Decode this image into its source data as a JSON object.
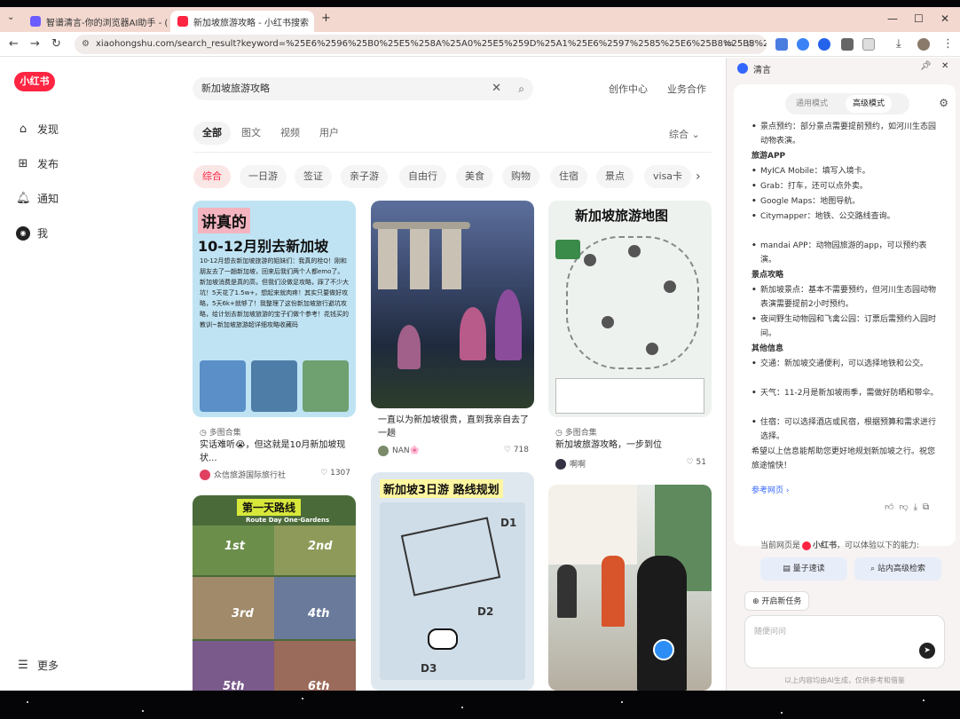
{
  "browser": {
    "tabs": [
      {
        "title": "智谱清言-你的浏览器AI助手 - (",
        "active": false
      },
      {
        "title": "新加坡旅游攻略 - 小红书搜索",
        "active": true
      }
    ],
    "new_tab": "+",
    "url": "xiaohongshu.com/search_result?keyword=%25E6%2596%25B0%25E5%258A%25A0%25E5%259D%25A1%25E6%2597%2585%25E6%25B8%25B8%2..."
  },
  "sidebar": {
    "logo": "小红书",
    "items": [
      {
        "label": "发现",
        "icon": "home-icon"
      },
      {
        "label": "发布",
        "icon": "plus-square-icon"
      },
      {
        "label": "通知",
        "icon": "bell-icon"
      },
      {
        "label": "我",
        "icon": "avatar-icon"
      }
    ],
    "more": "更多"
  },
  "search": {
    "value": "新加坡旅游攻略"
  },
  "top_links": [
    "创作中心",
    "业务合作"
  ],
  "filter_tabs": [
    "全部",
    "图文",
    "视频",
    "用户"
  ],
  "sort": "综合",
  "chips": [
    "综合",
    "一日游",
    "签证",
    "亲子游",
    "自由行",
    "美食",
    "购物",
    "住宿",
    "景点",
    "visa卡"
  ],
  "cards": [
    {
      "collection": "多图合集",
      "title": "实话难听😭，但这就是10月新加坡现状...",
      "user": "众信旅游国际旅行社",
      "likes": "1307",
      "poster_top": "讲真的",
      "poster_main": "10-12月别去新加坡",
      "poster_body": "10-12月想去新加坡旅游的姐妹们：我真的栓Q！刚和朋友去了一趟新加坡，回来后我们两个人都emo了。新加坡消费是真的高，但我们没做足攻略，踩了不少大坑！5天花了1.5w+，想起来就肉疼！其实只要做好攻略，5天6k+就够了！我整理了这份新加坡旅行避坑攻略，给计划去新加坡旅游的宝子们做个参考！花钱买的教训~新加坡旅游超详细攻略收藏码"
    },
    {
      "title": "一直以为新加坡很贵，直到我亲自去了一趟",
      "user": "NAN🌸",
      "likes": "718"
    },
    {
      "collection": "多图合集",
      "title": "新加坡旅游攻略，一步到位",
      "user": "啊啊",
      "likes": "51",
      "poster_main": "新加坡旅游地图"
    },
    {
      "poster_main": "第一天路线",
      "poster_sub": "Route Day One·Gardens",
      "spots": [
        "1st",
        "2nd",
        "3rd",
        "4th",
        "5th",
        "6th"
      ]
    },
    {
      "poster_main": "新加坡3日游 路线规划",
      "days": [
        "D1",
        "D2",
        "D3"
      ]
    },
    {}
  ],
  "assistant": {
    "title": "清言",
    "modes": [
      "通用模式",
      "高级模式"
    ],
    "answer": [
      {
        "t": "景点预约：部分景点需要提前预约，如河川生态园动物表演。",
        "k": "li"
      },
      {
        "t": "旅游APP",
        "k": "h"
      },
      {
        "t": "MyICA Mobile：填写入境卡。",
        "k": "li"
      },
      {
        "t": "Grab：打车，还可以点外卖。",
        "k": "li"
      },
      {
        "t": "Google Maps：地图导航。",
        "k": "li"
      },
      {
        "t": "Citymapper：地铁、公交路线查询。",
        "k": "li"
      },
      {
        "t": "mandai APP：动物园旅游的app，可以预约表演。",
        "k": "li"
      },
      {
        "t": "景点攻略",
        "k": "h"
      },
      {
        "t": "新加坡景点：基本不需要预约，但河川生态园动物表演需要提前2小时预约。",
        "k": "li"
      },
      {
        "t": "夜间野生动物园和飞禽公园：订票后需预约入园时间。",
        "k": "li"
      },
      {
        "t": "其他信息",
        "k": "h"
      },
      {
        "t": "交通：新加坡交通便利，可以选择地铁和公交。",
        "k": "li"
      },
      {
        "t": "天气：11-2月是新加坡雨季，需做好防晒和带伞。",
        "k": "li"
      },
      {
        "t": "住宿：可以选择酒店或民宿，根据预算和需求进行选择。",
        "k": "li"
      },
      {
        "t": "希望以上信息能帮助您更好地规划新加坡之行。祝您旅途愉快！",
        "k": "p"
      }
    ],
    "reference": "参考网页",
    "context_prefix": "当前网页是",
    "context_site": "小红书",
    "context_suffix": "，可以体验以下的能力:",
    "quick_actions": [
      "量子速读",
      "站内高级检索"
    ],
    "new_task": "开启新任务",
    "input_placeholder": "随便问问",
    "disclaimer": "以上内容均由AI生成，仅供参考和借鉴"
  },
  "colors": {
    "brand": "#ff2442",
    "tab_strip": "#f3d8cf",
    "assistant_bg": "#f7f3f2"
  }
}
